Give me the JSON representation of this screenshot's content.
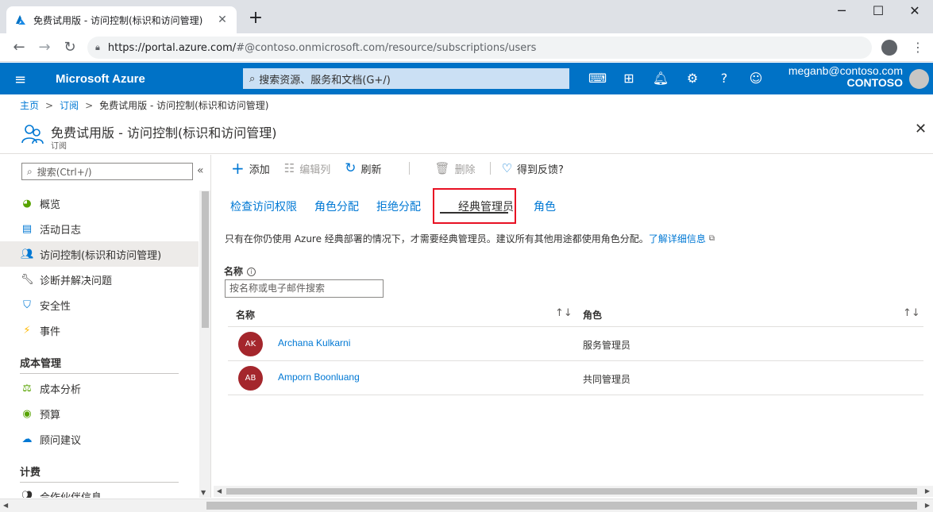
{
  "browser": {
    "tab_title": "免费试用版 - 访问控制(标识和访问管理)",
    "tab_close": "✕",
    "new_tab": "+",
    "url_prefix": "https://portal.azure.com/",
    "url_rest": "#@contoso.onmicrosoft.com/resource/subscriptions/users",
    "controls": {
      "minimize": "─",
      "maximize": "☐",
      "close": "✕"
    }
  },
  "azure": {
    "brand": "Microsoft Azure",
    "search_placeholder": "搜索资源、服务和文档(G+/)",
    "user_email": "meganb@contoso.com",
    "user_org": "CONTOSO",
    "icons": [
      "cloud-shell-icon",
      "directory-filter-icon",
      "notifications-icon",
      "settings-icon",
      "help-icon",
      "feedback-icon"
    ]
  },
  "breadcrumb": {
    "items": [
      "主页",
      "订阅",
      "免费试用版 - 访问控制(标识和访问管理)"
    ],
    "separator": ">"
  },
  "blade": {
    "title": "免费试用版 - 访问控制(标识和访问管理)",
    "subtitle": "订阅"
  },
  "leftnav": {
    "search_placeholder": "搜索(Ctrl+/)",
    "collapse": "«",
    "items": [
      {
        "label": "概览",
        "icon": "overview-icon"
      },
      {
        "label": "活动日志",
        "icon": "activity-log-icon"
      },
      {
        "label": "访问控制(标识和访问管理)",
        "icon": "access-control-icon",
        "selected": true
      },
      {
        "label": "诊断并解决问题",
        "icon": "wrench-icon"
      },
      {
        "label": "安全性",
        "icon": "shield-icon"
      },
      {
        "label": "事件",
        "icon": "lightning-icon"
      }
    ],
    "section_cost": "成本管理",
    "cost_items": [
      {
        "label": "成本分析",
        "icon": "cost-analysis-icon"
      },
      {
        "label": "预算",
        "icon": "budget-icon"
      },
      {
        "label": "顾问建议",
        "icon": "advisor-icon"
      }
    ],
    "section_billing": "计费",
    "billing_items": [
      {
        "label": "合作伙伴信息",
        "icon": "partner-icon"
      }
    ]
  },
  "commands": {
    "add": "添加",
    "edit_columns": "编辑列",
    "refresh": "刷新",
    "delete": "删除",
    "feedback": "得到反馈?"
  },
  "tabs": {
    "check_access": "检查访问权限",
    "role_assignments": "角色分配",
    "deny_assignments": "拒绝分配",
    "classic_admins": "经典管理员",
    "roles": "角色"
  },
  "info_text": "只有在你仍使用 Azure 经典部署的情况下，才需要经典管理员。建议所有其他用途都使用角色分配。",
  "info_link": "了解详细信息",
  "filter": {
    "label": "名称",
    "placeholder": "按名称或电子邮件搜索"
  },
  "table": {
    "col_name": "名称",
    "col_role": "角色",
    "sort_glyph": "↑↓",
    "rows": [
      {
        "initials": "AK",
        "name": "Archana Kulkarni",
        "role": "服务管理员"
      },
      {
        "initials": "AB",
        "name": "Amporn Boonluang",
        "role": "共同管理员"
      }
    ]
  },
  "colors": {
    "azure_blue": "#0072c6",
    "link_blue": "#0078d4",
    "avatar_red": "#a4262c",
    "highlight_red": "#e81123"
  }
}
